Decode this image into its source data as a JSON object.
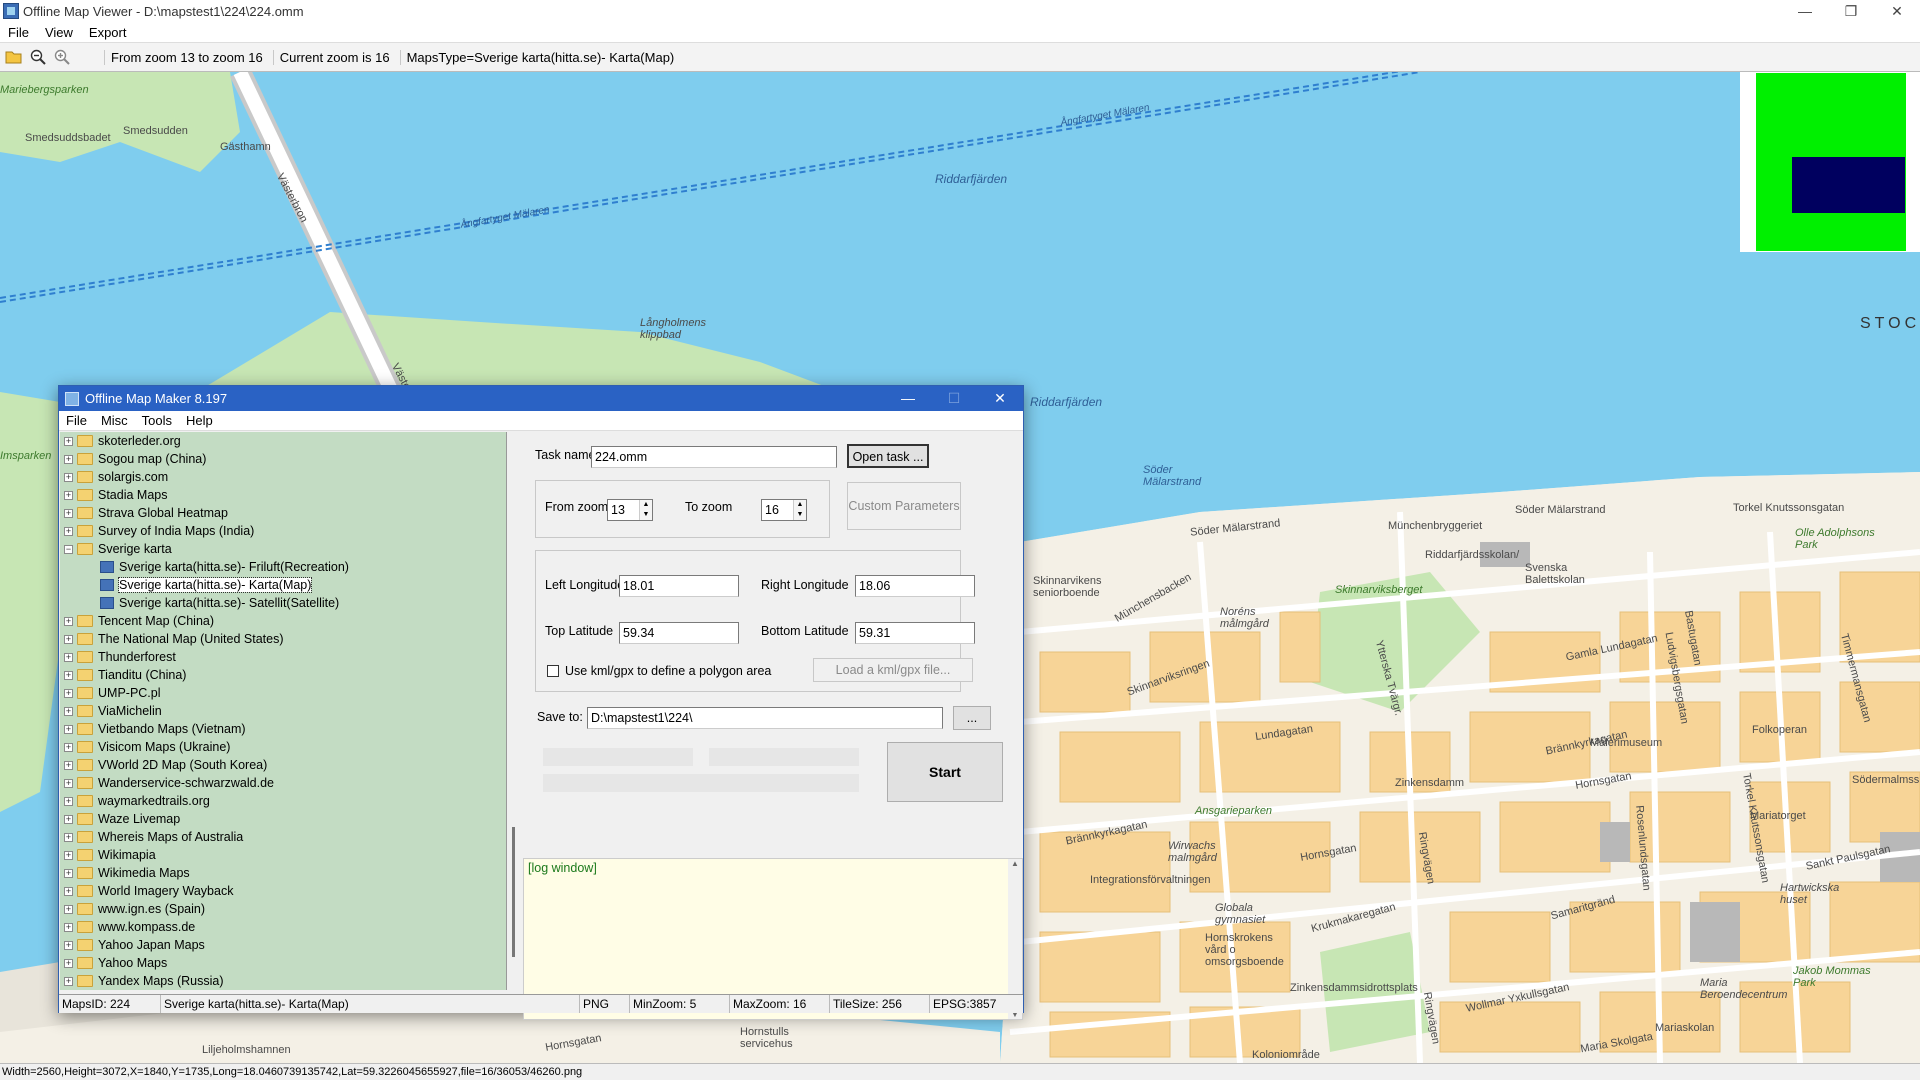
{
  "viewer": {
    "title": "Offline Map Viewer - D:\\mapstest1\\224\\224.omm",
    "menu": [
      "File",
      "View",
      "Export"
    ],
    "toolbar": {
      "zoom_range": "From zoom 13 to zoom 16",
      "current_zoom": "Current zoom is 16",
      "maps_type": "MapsType=Sverige karta(hitta.se)- Karta(Map)"
    },
    "statusbar": "Width=2560,Height=3072,X=1840,Y=1735,Long=18.0460739135742,Lat=59.3226045655927,file=16/36053/46260.png",
    "window_controls": [
      "—",
      "❐",
      "✕"
    ]
  },
  "map": {
    "labels": {
      "mariebergsparken": "Mariebergsparken",
      "smedsuddsbadet": "Smedsuddsbadet",
      "smedsudden": "Smedsudden",
      "gasthamn": "Gästhamn",
      "vasterbron1": "Västerbron",
      "vasterbron2": "Västerbron",
      "angfartyget1": "Ångfartyget Mälaren",
      "angfartyget2": "Ångfartyget Mälaren",
      "riddarfjarden1": "Riddarfjärden",
      "riddarfjarden2": "Riddarfjärden",
      "langholmens": "Långholmens klippbad",
      "stoc": "STOC",
      "imsparken": "Imsparken",
      "soder_malarstrand_water": "Söder Mälarstrand",
      "soder_malarstrand1": "Söder Mälarstrand",
      "soder_malarstrand2": "Söder Mälarstrand",
      "torkel": "Torkel Knutssonsgatan",
      "olle": "Olle Adolphsons Park",
      "munchenbryggeriet": "Münchenbryggeriet",
      "riddarfjardsskolan": "Riddarfjärdsskolan/",
      "svenska": "Svenska Balettskolan",
      "skinnarviksberget": "Skinnarviksberget",
      "skinnarvikens": "Skinnarvikens seniorboende",
      "munchensbacken": "Münchensbacken",
      "norens": "Noréns målmgård",
      "skinnarviksringen": "Skinnarviksringen",
      "gamla_lundagatan": "Gamla Lundagatan",
      "lundagatan": "Lundagatan",
      "brannkyrkagatan1": "Brännkyrkagatan",
      "brannkyrkagatan2": "Brännkyrkagatan",
      "malerimuseum": "Målerimuseum",
      "folkoperan": "Folkoperan",
      "zinkensdamm": "Zinkensdamm",
      "hornsgatan1": "Hornsgatan",
      "hornsgatan2": "Hornsgatan",
      "hornsgatan3": "Hornsgatan",
      "ansgarieparken": "Ansgarieparken",
      "wirwachs": "Wirwachs malmgård",
      "integrations": "Integrationsförvaltningen",
      "globala": "Globala gymnasiet",
      "hornskrokens": "Hornskrokens vård o omsorgsboende",
      "krukmakaregatan": "Krukmakaregatan",
      "zinkensdamms": "Zinkensdammsidrottsplats",
      "ringvagen1": "Ringvägen",
      "ringvagen2": "Ringvägen",
      "samaritgrand": "Samaritgränd",
      "rosenlundsgatan": "Rosenlundsgatan",
      "mariatorget": "Mariatorget",
      "sodermalmsskolan": "Södermalmsskol",
      "sankt_paulsgatan": "Sankt Paulsgatan",
      "hartwickska": "Hartwickska huset",
      "wollmar": "Wollmar Yxkullsgatan",
      "maria_beroende": "Maria Beroendecentrum",
      "jakob": "Jakob Mommas Park",
      "mariaskolan": "Mariaskolan",
      "maria_skolgata": "Maria Skolgata",
      "koloniomrade": "Koloniområde",
      "hornstulls": "Hornstulls servicehus",
      "liljeholmshamnen": "Liljeholmshamnen",
      "bastugatan": "Bastugatan",
      "ludvigsbergsgatan": "Ludvigsbergsgatan",
      "timmermansgatan": "Timmermansgatan",
      "torkel2": "Torkel Knutssonsgatan",
      "ytterska": "Ytterska Tvärgr."
    }
  },
  "dialog": {
    "title": "Offline Map Maker 8.197",
    "menu": [
      "File",
      "Misc",
      "Tools",
      "Help"
    ],
    "tree": [
      {
        "label": "skoterleder.org",
        "type": "folder"
      },
      {
        "label": "Sogou map (China)",
        "type": "folder"
      },
      {
        "label": "solargis.com",
        "type": "folder"
      },
      {
        "label": "Stadia Maps",
        "type": "folder"
      },
      {
        "label": "Strava Global Heatmap",
        "type": "folder"
      },
      {
        "label": "Survey of India Maps (India)",
        "type": "folder"
      },
      {
        "label": "Sverige karta",
        "type": "folder-open"
      },
      {
        "label": "Sverige karta(hitta.se)- Friluft(Recreation)",
        "type": "map"
      },
      {
        "label": "Sverige karta(hitta.se)- Karta(Map)",
        "type": "map",
        "selected": true
      },
      {
        "label": "Sverige karta(hitta.se)- Satellit(Satellite)",
        "type": "map"
      },
      {
        "label": "Tencent Map (China)",
        "type": "folder"
      },
      {
        "label": "The National Map (United States)",
        "type": "folder"
      },
      {
        "label": "Thunderforest",
        "type": "folder"
      },
      {
        "label": "Tianditu (China)",
        "type": "folder"
      },
      {
        "label": "UMP-PC.pl",
        "type": "folder"
      },
      {
        "label": "ViaMichelin",
        "type": "folder"
      },
      {
        "label": "Vietbando Maps (Vietnam)",
        "type": "folder"
      },
      {
        "label": "Visicom Maps (Ukraine)",
        "type": "folder"
      },
      {
        "label": "VWorld 2D Map (South Korea)",
        "type": "folder"
      },
      {
        "label": "Wanderservice-schwarzwald.de",
        "type": "folder"
      },
      {
        "label": "waymarkedtrails.org",
        "type": "folder"
      },
      {
        "label": "Waze Livemap",
        "type": "folder"
      },
      {
        "label": "Whereis Maps of Australia",
        "type": "folder"
      },
      {
        "label": "Wikimapia",
        "type": "folder"
      },
      {
        "label": "Wikimedia Maps",
        "type": "folder"
      },
      {
        "label": "World Imagery Wayback",
        "type": "folder"
      },
      {
        "label": "www.ign.es (Spain)",
        "type": "folder"
      },
      {
        "label": "www.kompass.de",
        "type": "folder"
      },
      {
        "label": "Yahoo Japan Maps",
        "type": "folder"
      },
      {
        "label": "Yahoo Maps",
        "type": "folder"
      },
      {
        "label": "Yandex Maps (Russia)",
        "type": "folder"
      }
    ],
    "form": {
      "task_name_label": "Task name",
      "task_name_value": "224.omm",
      "open_task_label": "Open task ...",
      "from_zoom_label": "From zoom",
      "from_zoom_value": "13",
      "to_zoom_label": "To zoom",
      "to_zoom_value": "16",
      "custom_params_label": "Custom Parameters",
      "left_lon_label": "Left Longitude",
      "left_lon_value": "18.01",
      "right_lon_label": "Right Longitude",
      "right_lon_value": "18.06",
      "top_lat_label": "Top Latitude",
      "top_lat_value": "59.34",
      "bottom_lat_label": "Bottom Latitude",
      "bottom_lat_value": "59.31",
      "kml_label": "Use kml/gpx to define a polygon area",
      "load_kml_label": "Load a kml/gpx file...",
      "save_to_label": "Save to:",
      "save_to_value": "D:\\mapstest1\\224\\",
      "browse_label": "...",
      "start_label": "Start",
      "log_text": "[log window]"
    },
    "statusbar": {
      "maps_id": "MapsID: 224",
      "maps_name": "Sverige karta(hitta.se)- Karta(Map)",
      "format": "PNG",
      "min_zoom": "MinZoom: 5",
      "max_zoom": "MaxZoom: 16",
      "tile_size": "TileSize: 256",
      "epsg": "EPSG:3857"
    },
    "window_controls": [
      "—",
      "☐",
      "✕"
    ]
  },
  "colors": {
    "water": "#7fcdee",
    "park": "#c7e6b4",
    "land": "#f4f0e6",
    "block": "#f7d497",
    "dialog_title": "#2a62c4",
    "tree_bg": "#c3dcc3",
    "log_bg": "#fffde6",
    "overview_green": "#00f000",
    "overview_blue": "#00005f"
  }
}
